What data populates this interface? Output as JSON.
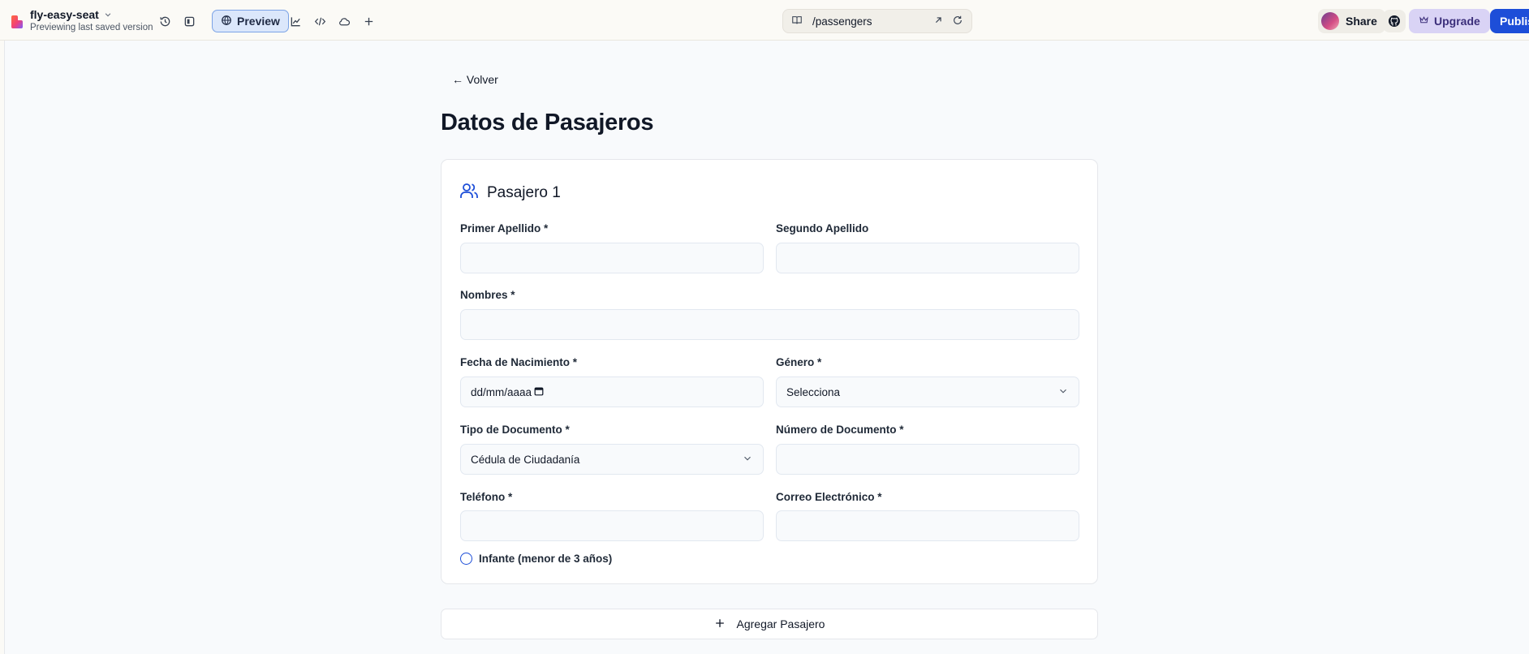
{
  "topbar": {
    "project_name": "fly-easy-seat",
    "project_status": "Previewing last saved version",
    "preview_label": "Preview",
    "url_path": "/passengers",
    "share_label": "Share",
    "upgrade_label": "Upgrade",
    "publish_label": "Publish"
  },
  "page": {
    "back_label": "← Volver",
    "title": "Datos de Pasajeros",
    "add_passenger_label": "Agregar Pasajero"
  },
  "passenger": {
    "heading": "Pasajero 1",
    "fields": {
      "first_surname": {
        "label": "Primer Apellido *",
        "value": ""
      },
      "second_surname": {
        "label": "Segundo Apellido",
        "value": ""
      },
      "names": {
        "label": "Nombres *",
        "value": ""
      },
      "birth_date": {
        "label": "Fecha de Nacimiento *",
        "placeholder": "dd/mm/aaaa"
      },
      "gender": {
        "label": "Género *",
        "selected": "Selecciona"
      },
      "document_type": {
        "label": "Tipo de Documento *",
        "selected": "Cédula de Ciudadanía"
      },
      "document_number": {
        "label": "Número de Documento *",
        "value": ""
      },
      "phone": {
        "label": "Teléfono *",
        "value": ""
      },
      "email": {
        "label": "Correo Electrónico *",
        "value": ""
      }
    },
    "infant_label": "Infante (menor de 3 años)",
    "infant_checked": false
  },
  "colors": {
    "accent": "#1d4ed8",
    "preview_bg": "#dbe7fb",
    "upgrade_bg": "#d9d3f5",
    "canvas_bg": "#f8fafc"
  },
  "icons": [
    "logo-icon",
    "chevron-down-icon",
    "history-icon",
    "sidebar-toggle-icon",
    "globe-icon",
    "chart-icon",
    "code-icon",
    "cloud-icon",
    "plus-icon",
    "book-icon",
    "external-link-icon",
    "refresh-icon",
    "github-icon",
    "crown-icon",
    "users-icon",
    "calendar-icon"
  ]
}
